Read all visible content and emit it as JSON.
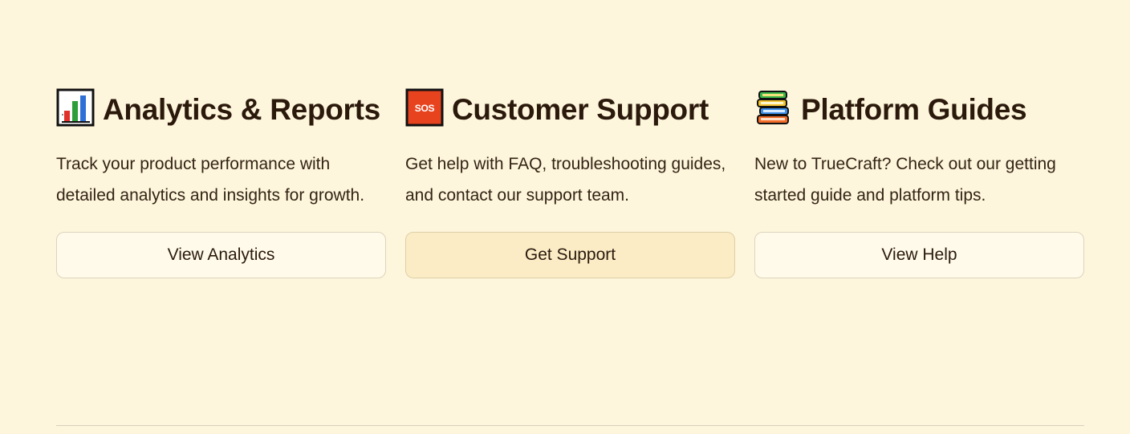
{
  "cards": [
    {
      "icon": "bar-chart-icon",
      "title": "Analytics & Reports",
      "description": "Track your product performance with detailed analytics and insights for growth.",
      "button_label": "View Analytics"
    },
    {
      "icon": "sos-icon",
      "title": "Customer Support",
      "description": "Get help with FAQ, troubleshooting guides, and contact our support team.",
      "button_label": "Get Support"
    },
    {
      "icon": "books-icon",
      "title": "Platform Guides",
      "description": "New to TrueCraft? Check out our getting started guide and platform tips.",
      "button_label": "View Help"
    }
  ],
  "colors": {
    "background": "#fef6dc",
    "text": "#2b1a0c",
    "button_background": "#fffaea",
    "button_primary_background": "#fbecc6",
    "button_border": "#dcd3bd"
  }
}
